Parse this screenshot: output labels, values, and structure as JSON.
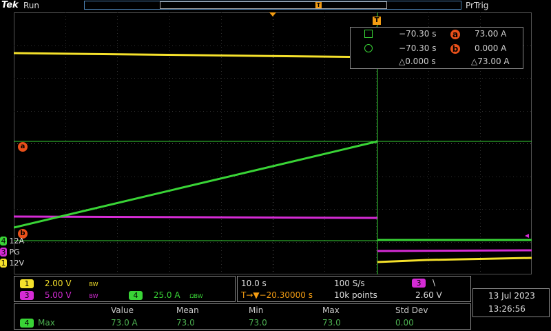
{
  "top": {
    "brand": "Tek",
    "run_state": "Run",
    "trigger_state": "PrTrig",
    "trigger_marker": "T"
  },
  "cursors": {
    "row1": {
      "time": "−70.30 s",
      "marker": "a",
      "value": "73.00 A"
    },
    "row2": {
      "time": "−70.30 s",
      "marker": "b",
      "value": "0.000 A"
    },
    "delta": {
      "time": "△0.000 s",
      "value": "△73.00 A"
    },
    "trigger_marker": "T"
  },
  "markers": {
    "a": "a",
    "b": "b"
  },
  "channel_tags": [
    {
      "num": "4",
      "label": "12A",
      "color": "#39d436"
    },
    {
      "num": "3",
      "label": "PG",
      "color": "#d52bd5"
    },
    {
      "num": "1",
      "label": "12V",
      "color": "#f5e12b"
    }
  ],
  "channels": {
    "ch1": {
      "num": "1",
      "scale": "2.00 V",
      "bw": "BW",
      "color": "#f5e12b"
    },
    "ch3": {
      "num": "3",
      "scale": "5.00 V",
      "bw": "BW",
      "color": "#d52bd5"
    },
    "ch4": {
      "num": "4",
      "scale": "25.0 A",
      "bw": "ΩBW",
      "color": "#39d436"
    }
  },
  "timebase": {
    "time_div": "10.0 s",
    "sample_rate": "100 S/s",
    "trig_pos": "T→▼−20.30000 s",
    "record_len": "10k points",
    "trig_ch": "3",
    "trig_slope": "\\",
    "trig_level": "2.60 V"
  },
  "datetime": {
    "date": "13 Jul  2023",
    "time": "13:26:56"
  },
  "measurements": {
    "headers": [
      "Value",
      "Mean",
      "Min",
      "Max",
      "Std Dev"
    ],
    "row": {
      "ch": "4",
      "name": "Max",
      "values": [
        "73.0 A",
        "73.0",
        "73.0",
        "73.0",
        "0.00"
      ]
    }
  }
}
